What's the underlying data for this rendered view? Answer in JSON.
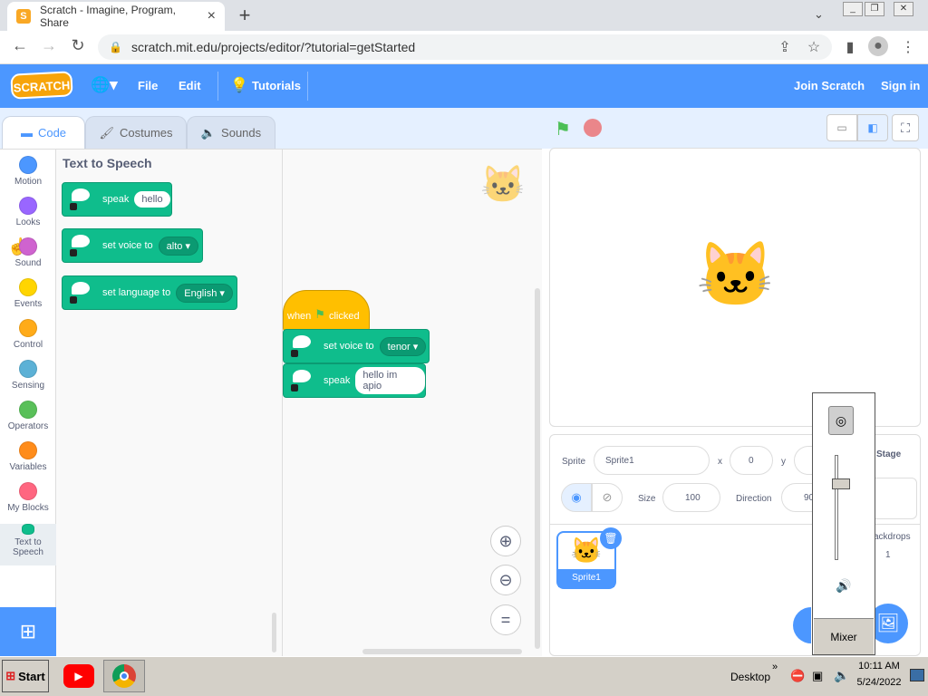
{
  "browser": {
    "tab_title": "Scratch - Imagine, Program, Share",
    "url": "scratch.mit.edu/projects/editor/?tutorial=getStarted"
  },
  "menubar": {
    "logo_text": "SCRATCH",
    "file": "File",
    "edit": "Edit",
    "tutorials": "Tutorials",
    "join": "Join Scratch",
    "signin": "Sign in"
  },
  "editor_tabs": {
    "code": "Code",
    "costumes": "Costumes",
    "sounds": "Sounds"
  },
  "categories": [
    {
      "label": "Motion",
      "color": "#4c97ff"
    },
    {
      "label": "Looks",
      "color": "#9966ff"
    },
    {
      "label": "Sound",
      "color": "#cf63cf"
    },
    {
      "label": "Events",
      "color": "#ffd500"
    },
    {
      "label": "Control",
      "color": "#ffab19"
    },
    {
      "label": "Sensing",
      "color": "#5cb1d6"
    },
    {
      "label": "Operators",
      "color": "#59c059"
    },
    {
      "label": "Variables",
      "color": "#ff8c1a"
    },
    {
      "label": "My Blocks",
      "color": "#ff6680"
    },
    {
      "label": "Text to Speech",
      "color": "#0fbd8c"
    }
  ],
  "palette": {
    "title": "Text to Speech",
    "blocks": [
      {
        "label": "speak",
        "input": "hello"
      },
      {
        "label": "set voice to",
        "input": "alto"
      },
      {
        "label": "set language to",
        "input": "English"
      }
    ]
  },
  "script": {
    "hat_when": "when",
    "hat_clicked": "clicked",
    "block1_label": "set voice to",
    "block1_input": "tenor",
    "block2_label": "speak",
    "block2_input": "hello im apio"
  },
  "sprite_info": {
    "sprite_label": "Sprite",
    "sprite_name": "Sprite1",
    "x_label": "x",
    "x_value": "0",
    "y_label": "y",
    "size_label": "Size",
    "size_value": "100",
    "direction_label": "Direction",
    "direction_value": "90",
    "stage_label": "Stage",
    "backdrops_label": "ackdrops",
    "backdrops_count": "1",
    "thumb_name": "Sprite1"
  },
  "mixer": {
    "label": "Mixer",
    "volume_fraction": 0.75
  },
  "taskbar": {
    "start": "Start",
    "desktop": "Desktop",
    "time": "10:11 AM",
    "date": "5/24/2022"
  }
}
